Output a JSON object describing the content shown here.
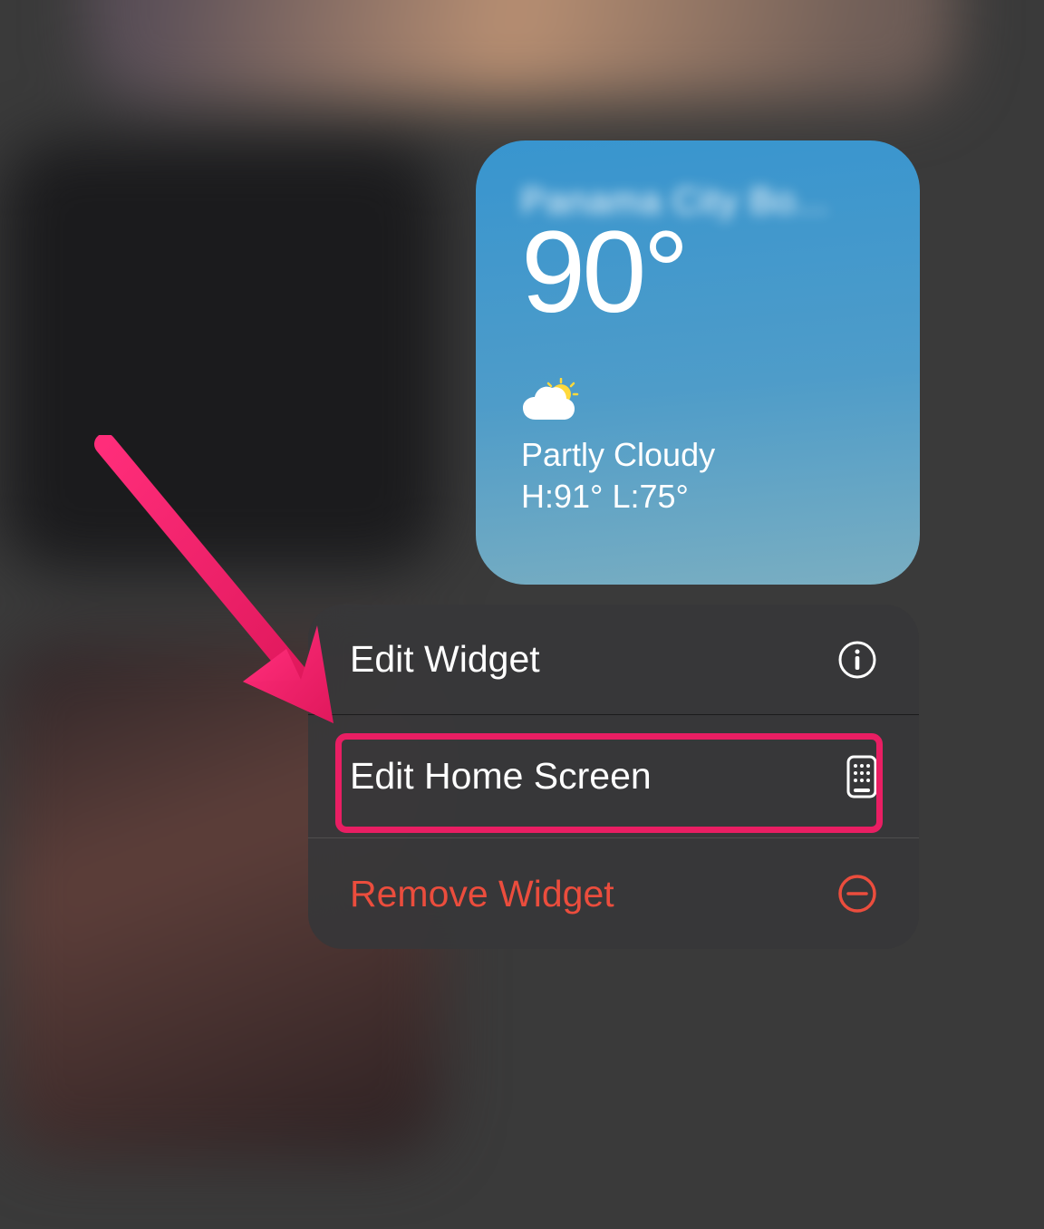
{
  "weather": {
    "location_blurred": "Panama City Bo...",
    "temperature": "90°",
    "condition": "Partly Cloudy",
    "high_low": "H:91° L:75°",
    "icon": "partly-cloudy-icon"
  },
  "context_menu": {
    "items": [
      {
        "label": "Edit Widget",
        "icon": "info-circle-icon",
        "danger": false
      },
      {
        "label": "Edit Home Screen",
        "icon": "edit-homescreen-icon",
        "danger": false,
        "highlighted": true
      },
      {
        "label": "Remove Widget",
        "icon": "remove-circle-icon",
        "danger": true
      }
    ]
  },
  "annotation": {
    "arrow_color": "#e91e63",
    "highlight_color": "#e91e63"
  }
}
